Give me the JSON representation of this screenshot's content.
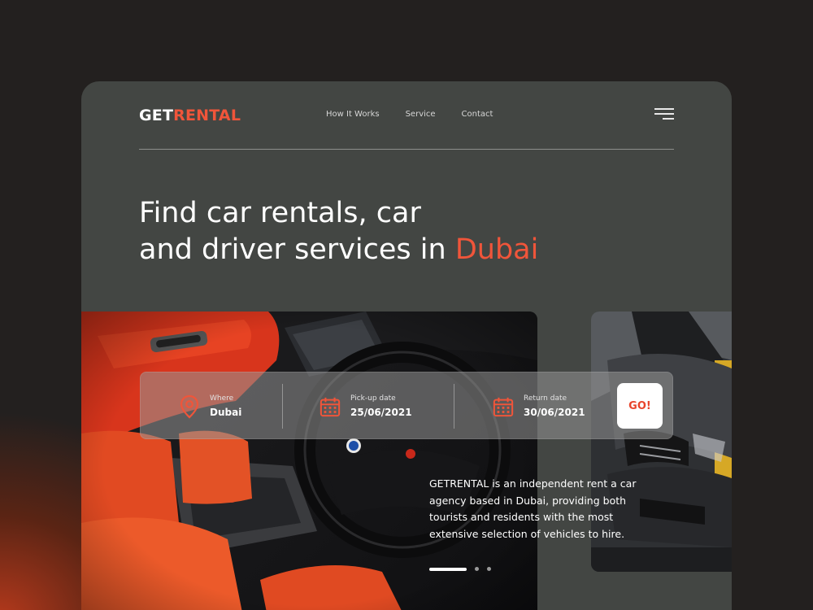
{
  "brand": {
    "part1": "GET",
    "part2": "RENTAL",
    "accent_color": "#f0553a"
  },
  "nav": {
    "items": [
      "How It Works",
      "Service",
      "Contact"
    ]
  },
  "hero": {
    "line1": "Find car rentals, car",
    "line2_prefix": "and driver services in ",
    "line2_accent": "Dubai"
  },
  "search": {
    "where": {
      "label": "Where",
      "value": "Dubai",
      "icon": "location-pin-icon"
    },
    "pickup": {
      "label": "Pick-up date",
      "value": "25/06/2021",
      "icon": "calendar-icon"
    },
    "return": {
      "label": "Return date",
      "value": "30/06/2021",
      "icon": "calendar-icon"
    },
    "go_label": "GO!"
  },
  "description": "GETRENTAL is an independent rent a car agency based in Dubai, providing both tourists and residents with the most extensive selection of vehicles to hire.",
  "carousel": {
    "total": 3,
    "active": 1
  }
}
